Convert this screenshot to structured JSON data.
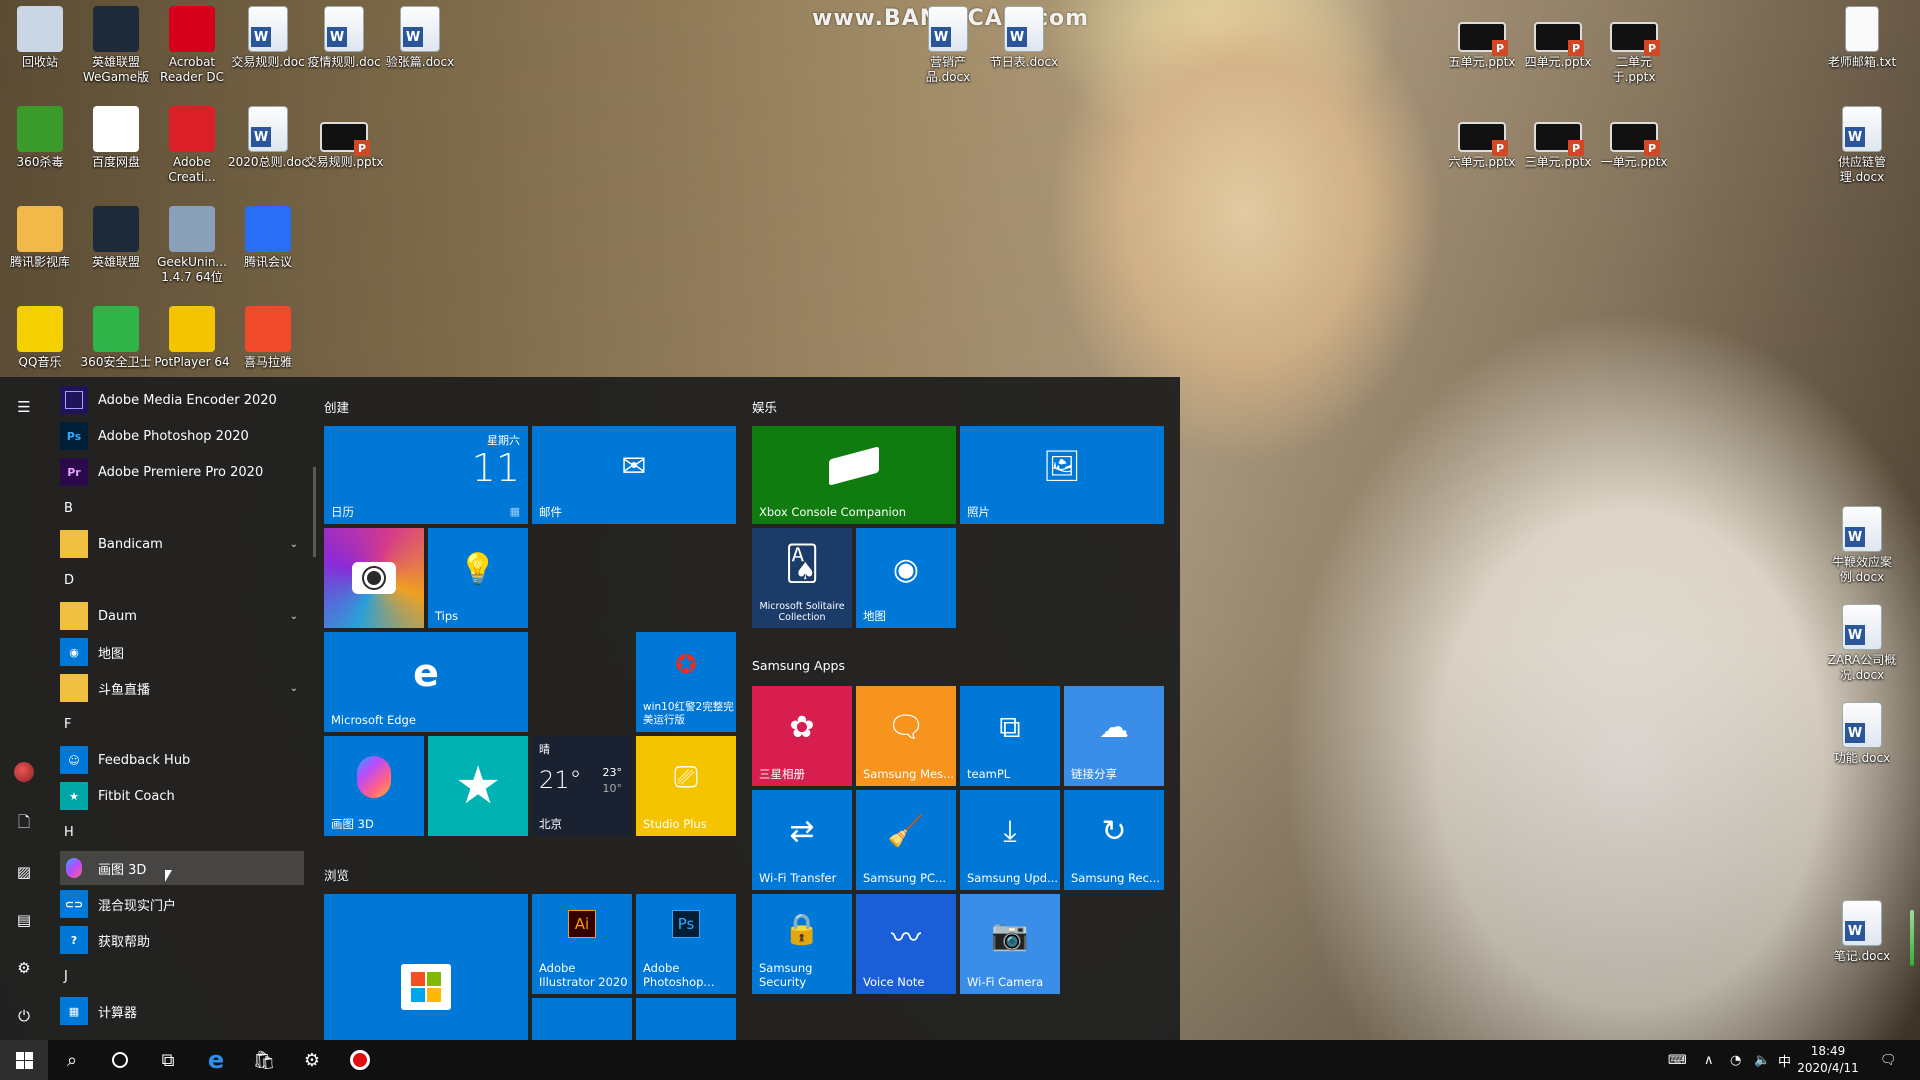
{
  "watermark": "www.BANDICAM.com",
  "desktop": {
    "icons": [
      {
        "label": "回收站",
        "icon": "recycle-bin-icon",
        "color": "#c9d6e6"
      },
      {
        "label": "英雄联盟WeGame版",
        "icon": "league-of-legends-icon",
        "color": "#1e2a3a"
      },
      {
        "label": "Acrobat Reader DC",
        "icon": "acrobat-icon",
        "color": "#d6001c"
      },
      {
        "label": "交易规则.doc",
        "icon": "word-doc-icon"
      },
      {
        "label": "疫情规则.doc",
        "icon": "word-doc-icon"
      },
      {
        "label": "验张篇.docx",
        "icon": "word-doc-icon"
      },
      {
        "label": "360杀毒",
        "icon": "360-antivirus-icon",
        "color": "#3a9a2a"
      },
      {
        "label": "百度网盘",
        "icon": "baidu-netdisk-icon",
        "color": "#ffffff"
      },
      {
        "label": "Adobe Creati...",
        "icon": "adobe-cc-icon",
        "color": "#da1f26"
      },
      {
        "label": "2020总则.doc",
        "icon": "word-doc-icon"
      },
      {
        "label": "交易规则.pptx",
        "icon": "pptx-thumb-icon"
      },
      {
        "label": "腾讯影视库",
        "icon": "folder-icon",
        "color": "#f0b94a"
      },
      {
        "label": "英雄联盟",
        "icon": "league-of-legends-icon",
        "color": "#1e2a3a"
      },
      {
        "label": "GeekUnin... 1.4.7 64位",
        "icon": "geek-uninstaller-icon",
        "color": "#8aa0b8"
      },
      {
        "label": "腾讯会议",
        "icon": "tencent-meeting-icon",
        "color": "#2a6ef5"
      },
      {
        "label": "QQ音乐",
        "icon": "qq-music-icon",
        "color": "#f5d000"
      },
      {
        "label": "360安全卫士",
        "icon": "360-safe-icon",
        "color": "#2fb44a"
      },
      {
        "label": "PotPlayer 64",
        "icon": "potplayer-icon",
        "color": "#f5c400"
      },
      {
        "label": "喜马拉雅",
        "icon": "ximalaya-icon",
        "color": "#f04a2a"
      },
      {
        "label": "营销产品.docx",
        "icon": "word-doc-icon"
      },
      {
        "label": "节日表.docx",
        "icon": "word-doc-icon"
      },
      {
        "label": "五单元.pptx",
        "icon": "pptx-thumb-icon"
      },
      {
        "label": "四单元.pptx",
        "icon": "pptx-thumb-icon"
      },
      {
        "label": "二单元 于.pptx",
        "icon": "pptx-thumb-icon"
      },
      {
        "label": "老师邮箱.txt",
        "icon": "text-file-icon"
      },
      {
        "label": "六单元.pptx",
        "icon": "pptx-thumb-icon"
      },
      {
        "label": "三单元.pptx",
        "icon": "pptx-thumb-icon"
      },
      {
        "label": "一单元.pptx",
        "icon": "pptx-thumb-icon"
      },
      {
        "label": "供应链管理.docx",
        "icon": "word-doc-icon"
      },
      {
        "label": "牛鞭效应案例.docx",
        "icon": "word-doc-icon"
      },
      {
        "label": "ZARA公司概况.docx",
        "icon": "word-doc-icon"
      },
      {
        "label": "功能.docx",
        "icon": "word-doc-icon"
      },
      {
        "label": "笔记.docx",
        "icon": "word-doc-icon"
      }
    ]
  },
  "start_menu": {
    "apps": [
      {
        "label": "Adobe Media Encoder 2020",
        "badge": "",
        "color": "#1f1457"
      },
      {
        "label": "Adobe Photoshop 2020",
        "badge": "Ps",
        "color": "#001e36"
      },
      {
        "label": "Adobe Premiere Pro 2020",
        "badge": "Pr",
        "color": "#2a0a4a"
      },
      {
        "label": "Bandicam",
        "badge": "",
        "color": "#f0c040"
      },
      {
        "label": "Daum",
        "badge": "",
        "color": "#f0c040"
      },
      {
        "label": "地图",
        "badge": "",
        "color": "#0078d7"
      },
      {
        "label": "斗鱼直播",
        "badge": "",
        "color": "#f0c040"
      },
      {
        "label": "Feedback Hub",
        "badge": "",
        "color": "#0078d7"
      },
      {
        "label": "Fitbit Coach",
        "badge": "★",
        "color": "#00a5a5"
      },
      {
        "label": "画图 3D",
        "badge": "",
        "color": "#2a2a2a"
      },
      {
        "label": "混合现实门户",
        "badge": "",
        "color": "#0078d7"
      },
      {
        "label": "获取帮助",
        "badge": "?",
        "color": "#0078d7"
      },
      {
        "label": "计算器",
        "badge": "",
        "color": "#0078d7"
      }
    ],
    "letters": [
      "B",
      "D",
      "F",
      "H",
      "J"
    ],
    "groups": {
      "create": "创建",
      "entertainment": "娱乐",
      "samsung": "Samsung Apps",
      "browse": "浏览"
    },
    "tiles": {
      "calendar": {
        "label": "日历",
        "weekday": "星期六",
        "day": "11"
      },
      "mail": {
        "label": "邮件"
      },
      "camera": {
        "label": ""
      },
      "tips": {
        "label": "Tips"
      },
      "edge": {
        "label": "Microsoft Edge"
      },
      "game": {
        "label": "win10红警2完整完美运行版"
      },
      "paint3d": {
        "label": "画图 3D"
      },
      "fitbit": {
        "label": ""
      },
      "weather": {
        "condition": "晴",
        "temp": "21°",
        "high": "23°",
        "low": "10°",
        "city": "北京"
      },
      "studio": {
        "label": "Studio Plus"
      },
      "store": {
        "label": ""
      },
      "illustrator": {
        "label": "Adobe Illustrator 2020"
      },
      "photoshop": {
        "label": "Adobe Photoshop..."
      },
      "xbox": {
        "label": "Xbox Console Companion"
      },
      "photos": {
        "label": "照片"
      },
      "solitaire": {
        "label": "Microsoft Solitaire Collection"
      },
      "maps": {
        "label": "地图"
      },
      "gallery": {
        "label": "三星相册"
      },
      "messages": {
        "label": "Samsung Mes..."
      },
      "teampl": {
        "label": "teamPL"
      },
      "linkshare": {
        "label": "链接分享"
      },
      "wifitransfer": {
        "label": "Wi-Fi Transfer"
      },
      "samsungpc": {
        "label": "Samsung PC..."
      },
      "samsungupd": {
        "label": "Samsung Upd..."
      },
      "samsungrec": {
        "label": "Samsung Rec..."
      },
      "security": {
        "label": "Samsung Security"
      },
      "voicenote": {
        "label": "Voice Note"
      },
      "wificamera": {
        "label": "Wi-Fi Camera"
      }
    }
  },
  "taskbar": {
    "ime": "中",
    "time": "18:49",
    "date": "2020/4/11"
  }
}
